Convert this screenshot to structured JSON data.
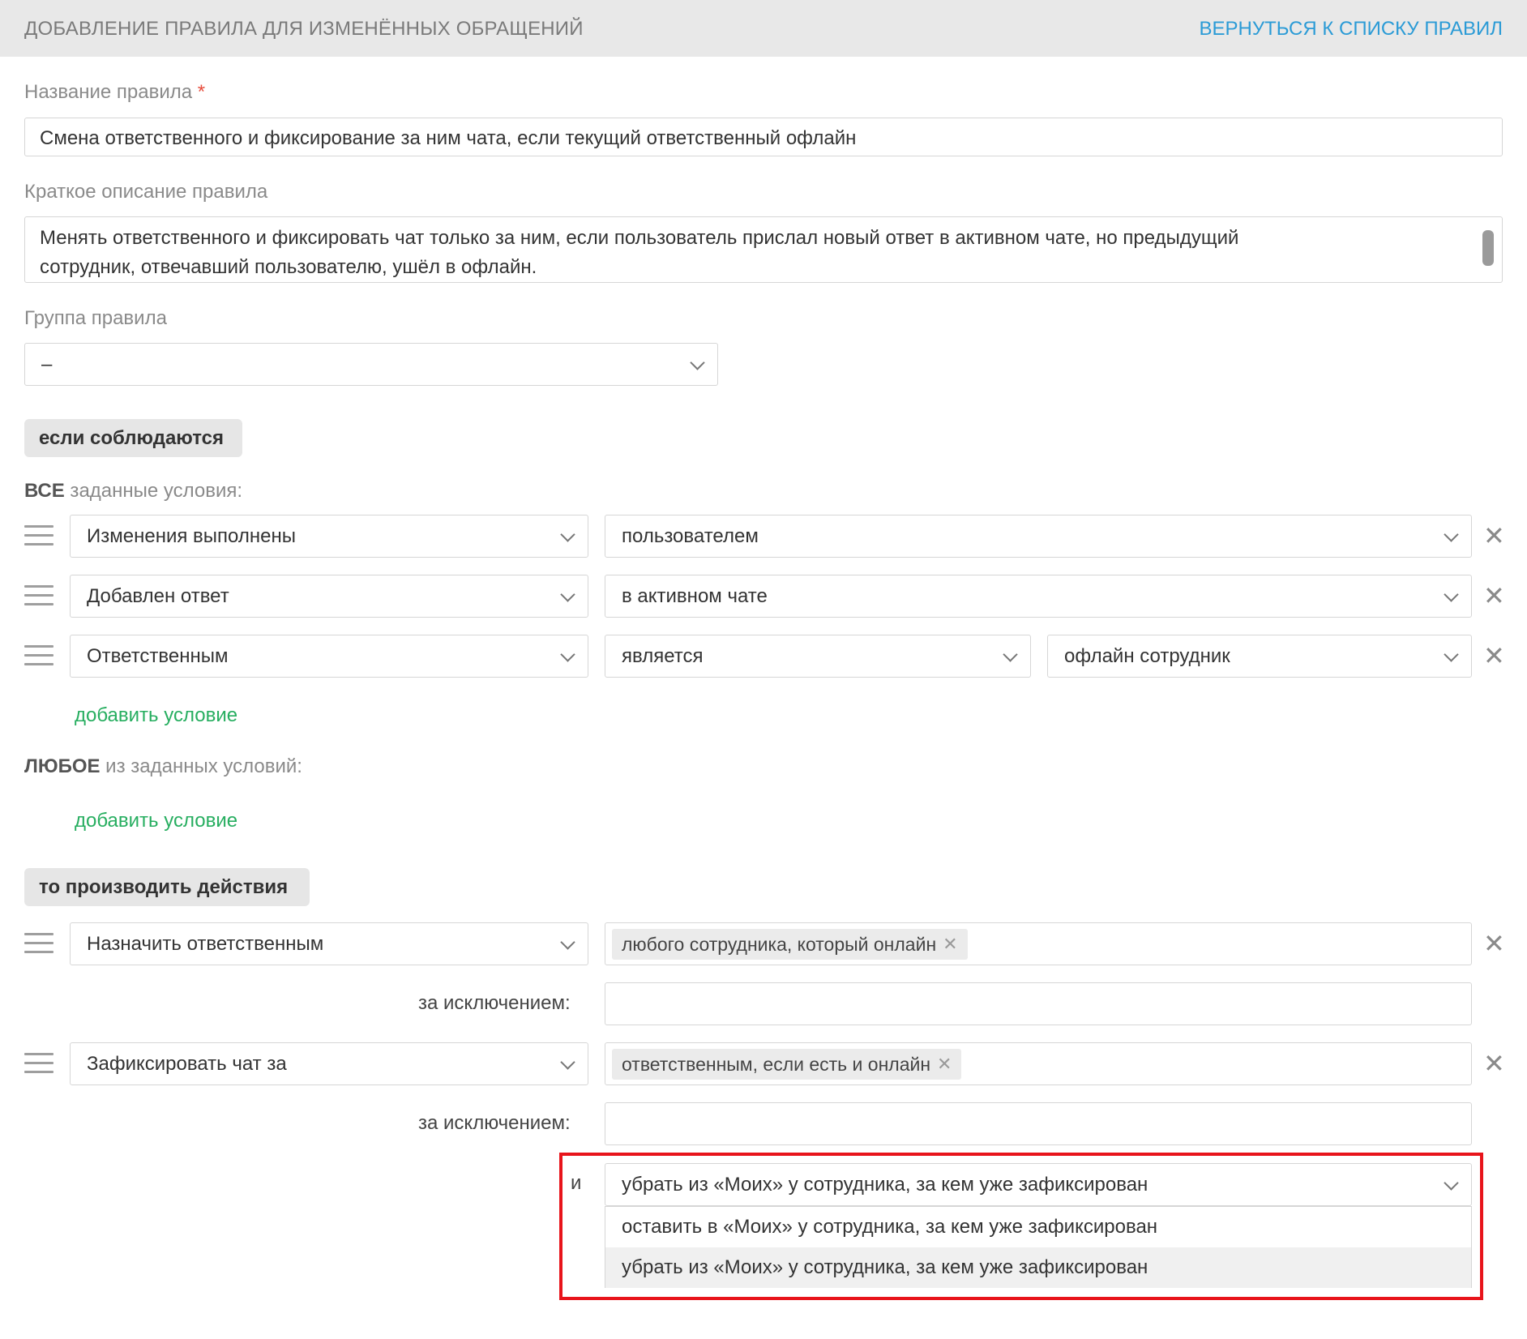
{
  "header": {
    "title": "ДОБАВЛЕНИЕ ПРАВИЛА ДЛЯ ИЗМЕНЁННЫХ ОБРАЩЕНИЙ",
    "back_link": "ВЕРНУТЬСЯ К СПИСКУ ПРАВИЛ"
  },
  "form": {
    "name_label": "Название правила",
    "name_required": "*",
    "name_value": "Смена ответственного и фиксирование за ним чата, если текущий ответственный офлайн",
    "desc_label": "Краткое описание правила",
    "desc_line1": "Менять ответственного и фиксировать чат только за ним, если пользователь прислал новый ответ в активном чате, но предыдущий",
    "desc_line2": "сотрудник, отвечавший пользователю, ушёл в офлайн.",
    "group_label": "Группа правила",
    "group_value": "–"
  },
  "conditions": {
    "section_label": "если соблюдаются",
    "all_bold": "ВСЕ",
    "all_rest": " заданные условия:",
    "rows": [
      {
        "field": "Изменения выполнены",
        "value": "пользователем"
      },
      {
        "field": "Добавлен ответ",
        "value": "в активном чате"
      },
      {
        "field": "Ответственным",
        "operator": "является",
        "value": "офлайн сотрудник"
      }
    ],
    "add_condition": "добавить условие",
    "any_bold": "ЛЮБОЕ",
    "any_rest": " из заданных условий:",
    "add_condition_any": "добавить условие"
  },
  "actions": {
    "section_label": "то производить действия",
    "rows": [
      {
        "action": "Назначить ответственным",
        "tag": "любого сотрудника, который онлайн",
        "except_label": "за исключением:"
      },
      {
        "action": "Зафиксировать чат за",
        "tag": "ответственным, если есть и онлайн",
        "except_label": "за исключением:"
      }
    ],
    "and_label": "и",
    "and_selected": "убрать из «Моих» у сотрудника, за кем уже зафиксирован",
    "and_options": [
      "оставить в «Моих» у сотрудника, за кем уже зафиксирован",
      "убрать из «Моих» у сотрудника, за кем уже зафиксирован"
    ]
  },
  "colors": {
    "link": "#2b9bd6",
    "add_link": "#27ae60",
    "required": "#e74c3c",
    "highlight": "#e8141b",
    "header_bg": "#e8e8e8"
  },
  "icons": {
    "remove": "✕",
    "chevron": "chevron-down-icon",
    "handle": "drag-handle-icon"
  }
}
